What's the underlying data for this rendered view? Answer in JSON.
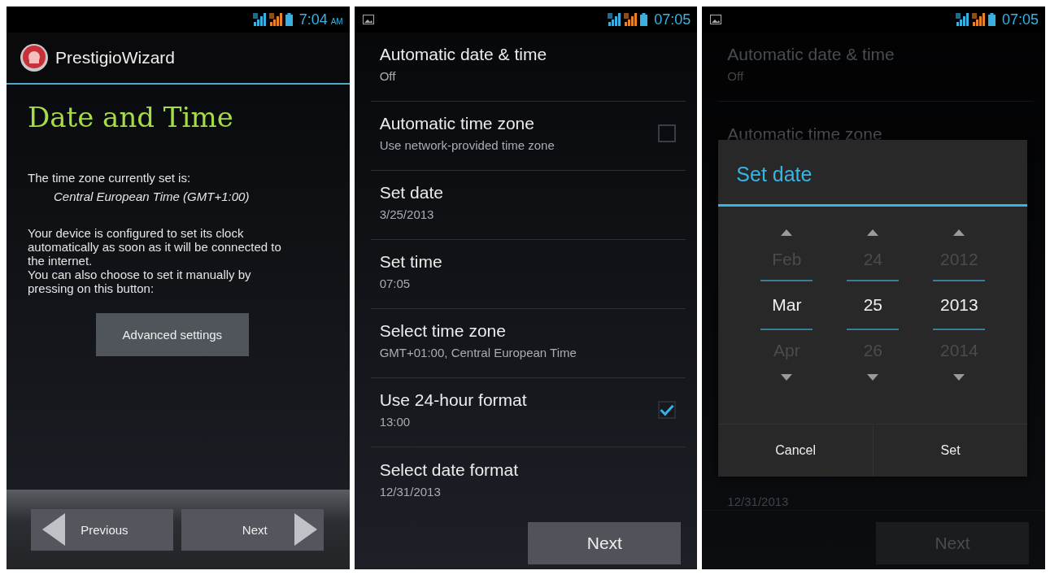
{
  "screens": [
    {
      "kind": "wizard",
      "status": {
        "notification": false,
        "time": "7:04",
        "suffix": "AM"
      },
      "app_title": "PrestigioWizard",
      "heading": "Date and Time",
      "texts": [
        {
          "kind": "plain",
          "text": "The time zone currently set is:"
        },
        {
          "kind": "italic",
          "text": "Central European Time (GMT+1:00)"
        },
        {
          "kind": "gap"
        },
        {
          "kind": "plain",
          "text": "Your device is configured to set its clock automatically as soon as it will be connected to the internet."
        },
        {
          "kind": "plain",
          "text": "You can also choose to set it manually by pressing on this button:"
        }
      ],
      "action_button": "Advanced settings",
      "nav": [
        {
          "kind": "back",
          "label": "Previous"
        },
        {
          "kind": "forward",
          "label": "Next"
        }
      ]
    },
    {
      "kind": "settings",
      "status": {
        "notification": true,
        "time": "07:05"
      },
      "items": [
        {
          "kind": "text",
          "title": "Automatic date & time",
          "summary": "Off"
        },
        {
          "kind": "checkbox",
          "title": "Automatic time zone",
          "summary": "Use network-provided time zone",
          "checked": false
        },
        {
          "kind": "text",
          "title": "Set date",
          "summary": "3/25/2013"
        },
        {
          "kind": "text",
          "title": "Set time",
          "summary": "07:05"
        },
        {
          "kind": "text",
          "title": "Select time zone",
          "summary": "GMT+01:00, Central European Time"
        },
        {
          "kind": "checkbox",
          "title": "Use 24-hour format",
          "summary": "13:00",
          "checked": true
        },
        {
          "kind": "text",
          "title": "Select date format",
          "summary": "12/31/2013"
        }
      ],
      "next_button": "Next"
    },
    {
      "kind": "date_dialog",
      "status": {
        "notification": true,
        "time": "07:05"
      },
      "background": {
        "top_items": [
          {
            "title": "Automatic date & time",
            "summary": "Off"
          },
          {
            "title": "Automatic time zone"
          }
        ],
        "bottom_items": [
          {
            "summary": "12/31/2013"
          }
        ],
        "next_button": "Next"
      },
      "dialog": {
        "title": "Set date",
        "columns": [
          {
            "previous": "Feb",
            "current": "Mar",
            "next": "Apr"
          },
          {
            "previous": "24",
            "current": "25",
            "next": "26"
          },
          {
            "previous": "2012",
            "current": "2013",
            "next": "2014"
          }
        ],
        "buttons": [
          "Cancel",
          "Set"
        ]
      }
    }
  ]
}
